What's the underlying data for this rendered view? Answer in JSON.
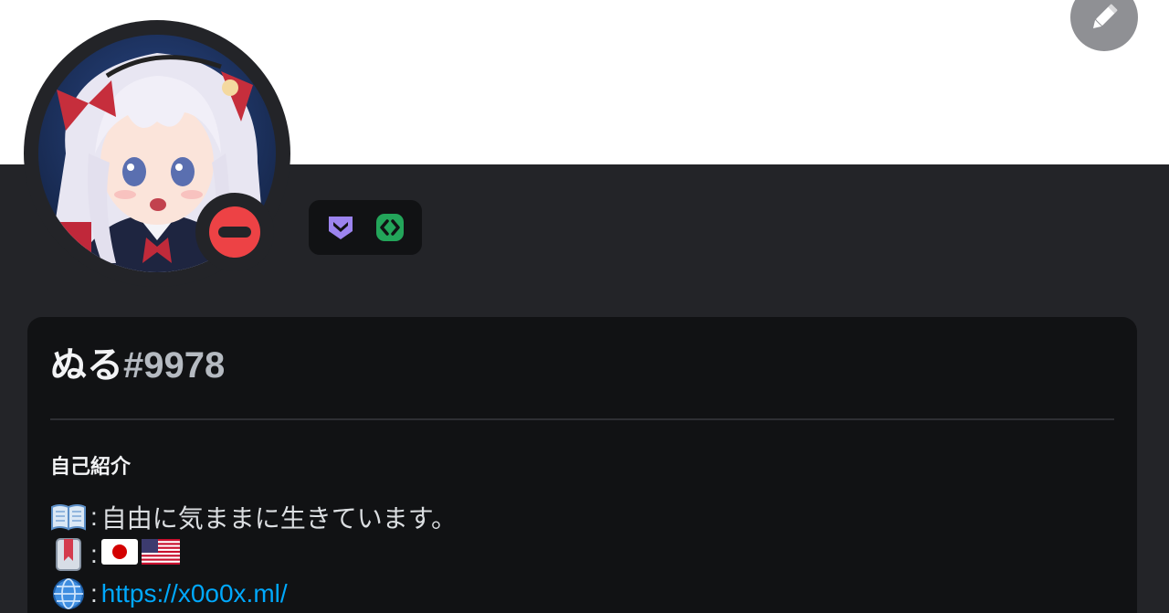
{
  "profile": {
    "username": "ぬる",
    "discriminator": "#9978",
    "status": "do-not-disturb",
    "badges": [
      {
        "name": "hypesquad-bravery-icon",
        "color": "#9c84ef"
      },
      {
        "name": "active-developer-icon",
        "color": "#23a55a"
      }
    ]
  },
  "about": {
    "title": "自己紹介",
    "lines": [
      {
        "icon": "open-book-icon",
        "separator": ":",
        "text": "自由に気ままに生きています。"
      },
      {
        "icon": "bookmark-icon",
        "separator": ":",
        "flags": [
          "japan-flag-icon",
          "usa-flag-icon"
        ]
      },
      {
        "icon": "globe-icon",
        "separator": ":",
        "link": "https://x0o0x.ml/"
      }
    ]
  },
  "colors": {
    "banner": "#ffffff",
    "background": "#232428",
    "card": "#111214",
    "dnd": "#ed4245",
    "link": "#00a8fc"
  }
}
